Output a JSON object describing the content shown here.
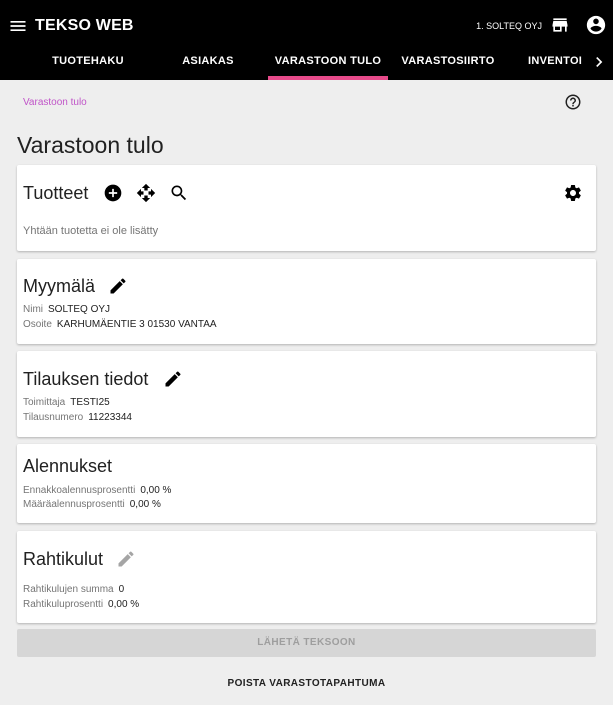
{
  "app": {
    "title": "TEKSO WEB",
    "organization": "1. SOLTEQ OYJ"
  },
  "tabs": [
    {
      "label": "TUOTEHAKU"
    },
    {
      "label": "ASIAKAS"
    },
    {
      "label": "VARASTOON TULO",
      "active": true
    },
    {
      "label": "VARASTOSIIRTO"
    },
    {
      "label": "INVENTOI"
    }
  ],
  "breadcrumb": "Varastoon tulo",
  "page_title": "Varastoon tulo",
  "products": {
    "title": "Tuotteet",
    "empty_text": "Yhtään tuotetta ei ole lisätty"
  },
  "store": {
    "title": "Myymälä",
    "name_label": "Nimi",
    "name_value": "SOLTEQ OYJ",
    "address_label": "Osoite",
    "address_value": "KARHUMÄENTIE 3 01530 VANTAA"
  },
  "order": {
    "title": "Tilauksen tiedot",
    "supplier_label": "Toimittaja",
    "supplier_value": "TESTI25",
    "order_number_label": "Tilausnumero",
    "order_number_value": "11223344"
  },
  "discounts": {
    "title": "Alennukset",
    "advance_label": "Ennakkoalennusprosentti",
    "advance_value": "0,00 %",
    "quantity_label": "Määräalennusprosentti",
    "quantity_value": "0,00 %"
  },
  "freight": {
    "title": "Rahtikulut",
    "sum_label": "Rahtikulujen summa",
    "sum_value": "0",
    "percent_label": "Rahtikuluprosentti",
    "percent_value": "0,00 %"
  },
  "actions": {
    "send_label": "LÄHETÄ TEKSOON",
    "delete_label": "POISTA VARASTOTAPAHTUMA"
  },
  "colors": {
    "appbar": "#000000",
    "accent": "#e64a8a",
    "breadcrumb": "#c054c8"
  }
}
